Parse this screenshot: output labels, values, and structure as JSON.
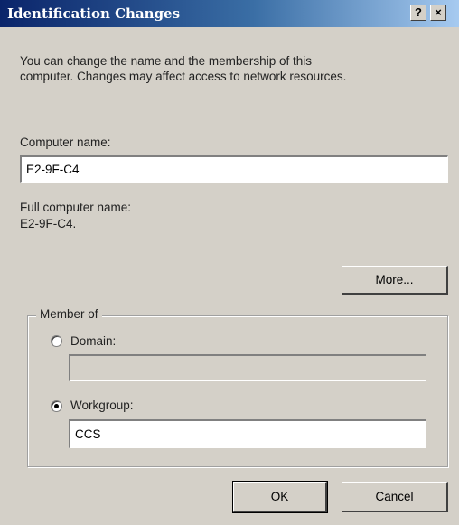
{
  "window": {
    "title": "Identification Changes",
    "help_label": "?",
    "close_label": "×"
  },
  "description": {
    "line1": "You can change the name and the membership of this",
    "line2": "computer. Changes may affect access to network resources."
  },
  "computer_name": {
    "label": "Computer name:",
    "value": "E2-9F-C4"
  },
  "full_name": {
    "label": "Full computer name:",
    "value": "E2-9F-C4."
  },
  "more_button": "More...",
  "member_of": {
    "label": "Member of",
    "domain": {
      "label": "Domain:",
      "selected": false,
      "value": ""
    },
    "workgroup": {
      "label": "Workgroup:",
      "selected": true,
      "value": "CCS"
    }
  },
  "buttons": {
    "ok": "OK",
    "cancel": "Cancel"
  }
}
